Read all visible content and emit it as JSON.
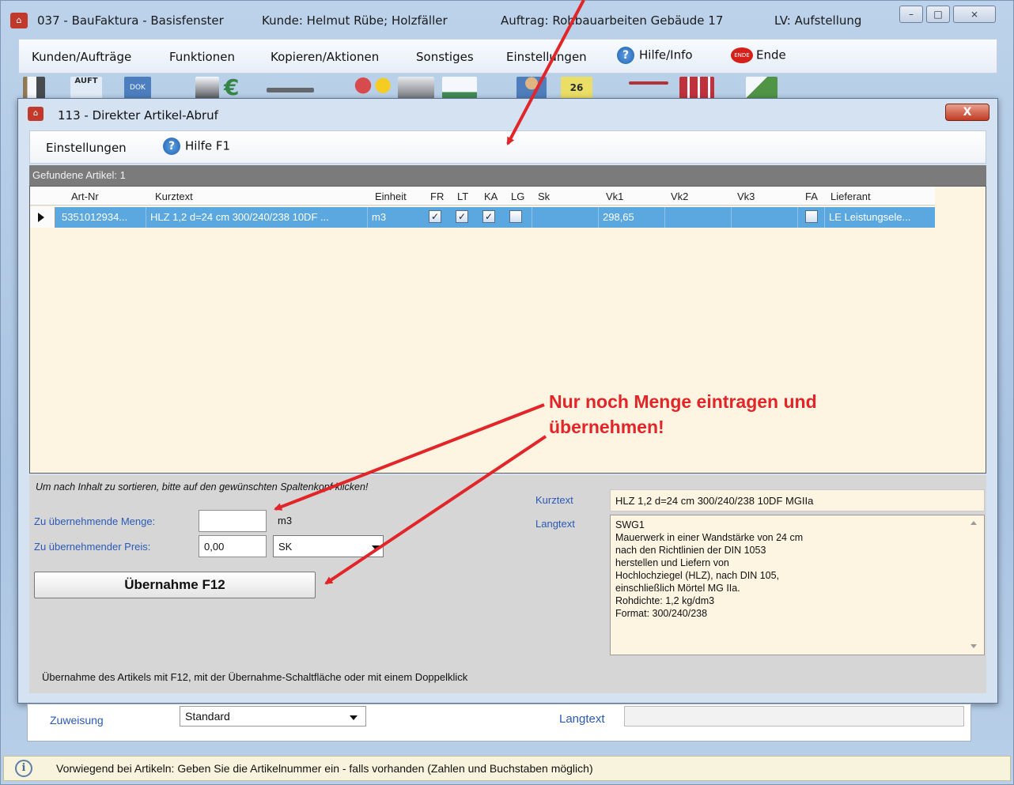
{
  "main_window": {
    "title_parts": {
      "app": "037 - BauFaktura - Basisfenster",
      "customer": "Kunde: Helmut Rübe; Holzfäller",
      "order": "Auftrag: Rohbauarbeiten Gebäude 17",
      "lv": "LV: Aufstellung"
    },
    "window_buttons": {
      "minimize": "–",
      "maximize": "□",
      "close": "⨯"
    },
    "menu": {
      "items": [
        "Kunden/Aufträge",
        "Funktionen",
        "Kopieren/Aktionen",
        "Sonstiges",
        "Einstellungen",
        "Hilfe/Info",
        "Ende"
      ],
      "help_glyph": "?",
      "ende_badge": "ENDE"
    },
    "toolbar_icons": [
      "document-icon",
      "auftrag-icon",
      "dok-icon",
      "form-icon",
      "euro-icon",
      "tool-icon",
      "people-icon",
      "machine-icon",
      "chart-icon",
      "worker-icon",
      "calendar-icon",
      "scale-icon",
      "grid-icon",
      "check-icon"
    ],
    "toolbar_text": {
      "auft": "AUFT",
      "dok": "DOK",
      "euro": "€",
      "calendar_num": "26"
    }
  },
  "dialog": {
    "title": "113 - Direkter Artikel-Abruf",
    "close_glyph": "X",
    "menu": {
      "settings": "Einstellungen",
      "help": "Hilfe F1",
      "help_glyph": "?"
    },
    "found_label": "Gefundene Artikel: 1",
    "grid": {
      "columns": [
        "Art-Nr",
        "Kurztext",
        "Einheit",
        "FR",
        "LT",
        "KA",
        "LG",
        "Sk",
        "Vk1",
        "Vk2",
        "Vk3",
        "FA",
        "Lieferant"
      ],
      "rows": [
        {
          "art_nr": "5351012934...",
          "kurztext": "HLZ 1,2 d=24 cm 300/240/238 10DF ...",
          "einheit": "m3",
          "fr": true,
          "lt": true,
          "ka": true,
          "lg": false,
          "sk": "",
          "vk1": "298,65",
          "vk2": "",
          "vk3": "",
          "fa": false,
          "lieferant": "LE Leistungsele..."
        }
      ]
    },
    "sort_hint": "Um nach Inhalt zu sortieren, bitte auf den gewünschten Spaltenkopf klicken!",
    "quantity_label": "Zu übernehmende Menge:",
    "quantity_value": "",
    "quantity_unit": "m3",
    "price_label": "Zu übernehmender Preis:",
    "price_value": "0,00",
    "price_type": "SK",
    "take_button": "Übernahme F12",
    "kurztext_label": "Kurztext",
    "kurztext_value": "HLZ 1,2 d=24 cm 300/240/238 10DF MGIIa",
    "langtext_label": "Langtext",
    "langtext_lines": [
      "SWG1",
      "Mauerwerk in einer Wandstärke von 24 cm",
      "nach den Richtlinien der DIN 1053",
      "herstellen und Liefern von",
      "Hochlochziegel (HLZ), nach DIN 105,",
      "einschließlich Mörtel MG IIa.",
      "Rohdichte: 1,2 kg/dm3",
      "Format: 300/240/238"
    ],
    "footer_note": "Übernahme des Artikels mit F12, mit der Übernahme-Schaltfläche oder mit einem Doppelklick"
  },
  "background_form": {
    "assignment_label": "Zuweisung",
    "assignment_value": "Standard",
    "langtext_label": "Langtext"
  },
  "statusbar": {
    "info_glyph": "i",
    "text": "Vorwiegend bei Artikeln: Geben Sie die Artikelnummer ein - falls vorhanden (Zahlen und Buchstaben möglich)"
  },
  "annotation": {
    "line1": "Nur noch Menge eintragen und",
    "line2": "übernehmen!",
    "color": "#e12528"
  },
  "colors": {
    "selected_row": "#5aa8df",
    "grid_background": "#fdf4e1",
    "label_blue": "#2a5ab5"
  }
}
